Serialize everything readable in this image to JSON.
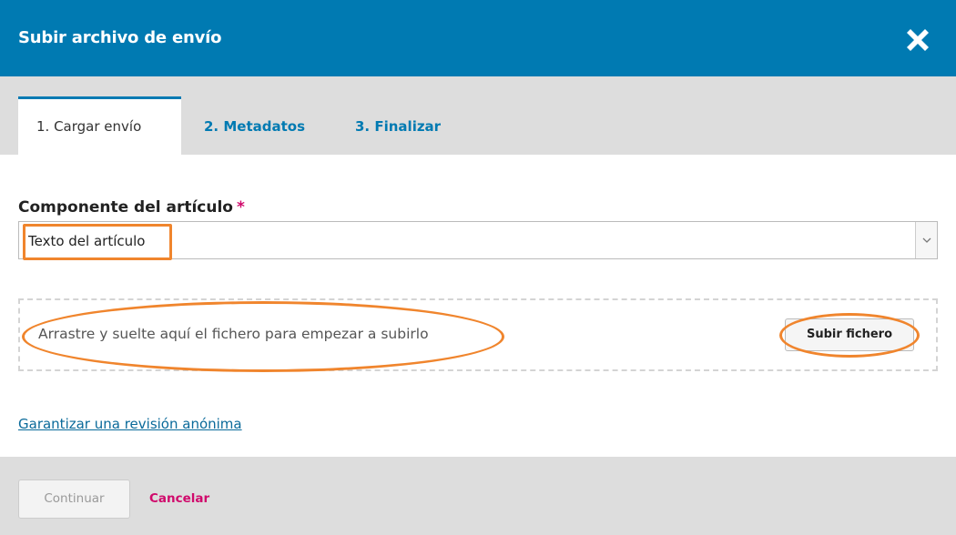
{
  "modal": {
    "title": "Subir archivo de envío",
    "close_icon": "close-x-icon"
  },
  "tabs": [
    {
      "label": "1. Cargar envío",
      "active": true
    },
    {
      "label": "2. Metadatos",
      "active": false
    },
    {
      "label": "3. Finalizar",
      "active": false
    }
  ],
  "form": {
    "component_label": "Componente del artículo",
    "required_marker": "*",
    "component_value": "Texto del artículo",
    "dropzone_text": "Arrastre y suelte aquí el fichero para empezar a subirlo",
    "upload_button": "Subir fichero",
    "anonymous_review_link": "Garantizar una revisión anónima"
  },
  "footer": {
    "continue_label": "Continuar",
    "cancel_label": "Cancelar"
  },
  "colors": {
    "header": "#007ab2",
    "tab_text": "#007ab2",
    "required": "#d00a6c",
    "cancel": "#d00a6c",
    "highlight": "#f0852d"
  }
}
